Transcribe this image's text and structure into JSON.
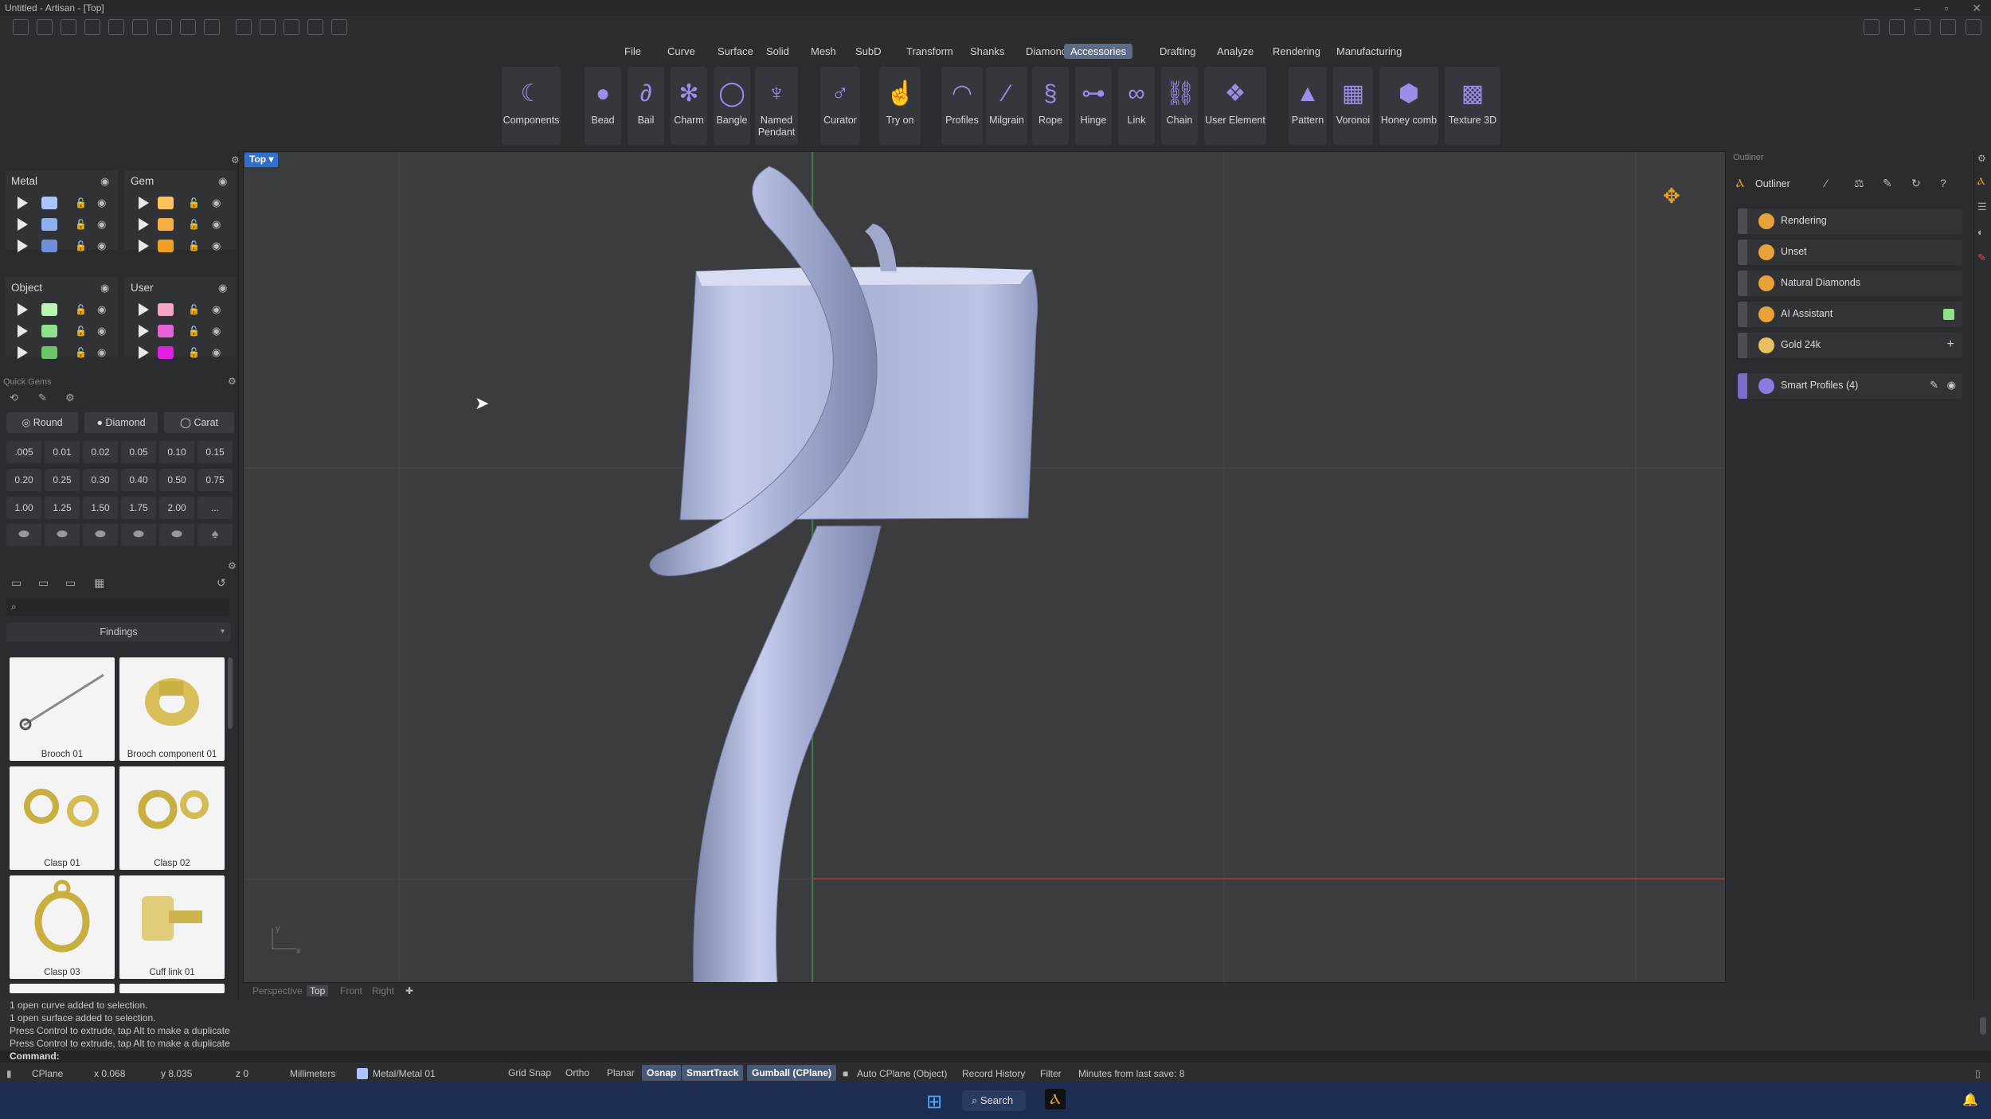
{
  "window": {
    "title": "Untitled - Artisan - [Top]"
  },
  "menu": [
    "File",
    "Curve",
    "Surface",
    "Solid",
    "Mesh",
    "SubD",
    "Transform",
    "Shanks",
    "Diamonds",
    "Accessories",
    "Drafting",
    "Analyze",
    "Rendering",
    "Manufacturing"
  ],
  "menu_active": "Accessories",
  "ribbon": {
    "tools": [
      {
        "label": "Components",
        "icon": "components-icon"
      },
      {
        "label": "Bead",
        "icon": "bead-icon"
      },
      {
        "label": "Bail",
        "icon": "bail-icon"
      },
      {
        "label": "Charm",
        "icon": "charm-icon"
      },
      {
        "label": "Bangle",
        "icon": "bangle-icon"
      },
      {
        "label": "Named Pendant",
        "icon": "named-pendant-icon"
      },
      {
        "label": "Curator",
        "icon": "curator-icon"
      },
      {
        "label": "Try on",
        "icon": "try-on-icon"
      },
      {
        "label": "Profiles",
        "icon": "profiles-icon"
      },
      {
        "label": "Milgrain",
        "icon": "milgrain-icon"
      },
      {
        "label": "Rope",
        "icon": "rope-icon"
      },
      {
        "label": "Hinge",
        "icon": "hinge-icon"
      },
      {
        "label": "Link",
        "icon": "link-icon"
      },
      {
        "label": "Chain",
        "icon": "chain-icon"
      },
      {
        "label": "User Element",
        "icon": "user-element-icon"
      },
      {
        "label": "Pattern",
        "icon": "pattern-icon"
      },
      {
        "label": "Voronoi",
        "icon": "voronoi-icon"
      },
      {
        "label": "Honey comb",
        "icon": "honeycomb-icon"
      },
      {
        "label": "Texture 3D",
        "icon": "texture-3d-icon"
      }
    ]
  },
  "layers": {
    "metal": {
      "title": "Metal",
      "colors": [
        "#a9c4ff",
        "#8db0f0",
        "#6f8fd8"
      ]
    },
    "gem": {
      "title": "Gem",
      "colors": [
        "#ffc15a",
        "#f7b040",
        "#f0a020"
      ]
    },
    "object": {
      "title": "Object",
      "colors": [
        "#b9f5b0",
        "#8fe08a",
        "#6cc468"
      ]
    },
    "user": {
      "title": "User",
      "colors": [
        "#f5a6c8",
        "#e860d8",
        "#e020e0"
      ]
    }
  },
  "quick_gems": {
    "title": "Quick Gems",
    "shape_buttons": [
      "Round",
      "Diamond",
      "Carat"
    ],
    "sizes": [
      ".005",
      "0.01",
      "0.02",
      "0.05",
      "0.10",
      "0.15",
      "0.20",
      "0.25",
      "0.30",
      "0.40",
      "0.50",
      "0.75",
      "1.00",
      "1.25",
      "1.50",
      "1.75",
      "2.00",
      "..."
    ]
  },
  "library": {
    "search_placeholder": "",
    "category": "Findings",
    "items": [
      "Brooch 01",
      "Brooch component 01",
      "Clasp 01",
      "Clasp 02",
      "Clasp 03",
      "Cuff link 01"
    ]
  },
  "viewport": {
    "label": "Top",
    "axis_y": "y",
    "axis_x": "x"
  },
  "view_tabs": [
    "Perspective",
    "Top",
    "Front",
    "Right"
  ],
  "view_tab_active": "Top",
  "outliner": {
    "title": "Outliner",
    "panel_label": "Outliner",
    "items": [
      {
        "label": "Rendering",
        "color": "#e8a23a"
      },
      {
        "label": "Unset",
        "color": "#e8a23a"
      },
      {
        "label": "Natural Diamonds",
        "color": "#e8a23a"
      },
      {
        "label": "AI Assistant",
        "color": "#e8a23a"
      },
      {
        "label": "Gold 24k",
        "color": "#e8c060"
      }
    ],
    "smart": "Smart Profiles (4)"
  },
  "history": [
    "1 open curve added to selection.",
    "1 open surface added to selection.",
    "Press Control to extrude, tap Alt to make a duplicate",
    "Press Control to extrude, tap Alt to make a duplicate"
  ],
  "command_label": "Command:",
  "status": {
    "cplane": "CPlane",
    "x": "x 0.068",
    "y": "y 8.035",
    "z": "z 0",
    "units": "Millimeters",
    "layer": "Metal/Metal 01",
    "toggles": [
      {
        "label": "Grid Snap",
        "on": false
      },
      {
        "label": "Ortho",
        "on": false
      },
      {
        "label": "Planar",
        "on": false
      },
      {
        "label": "Osnap",
        "on": true
      },
      {
        "label": "SmartTrack",
        "on": true
      },
      {
        "label": "Gumball (CPlane)",
        "on": true
      }
    ],
    "autocplane": "Auto CPlane (Object)",
    "record": "Record History",
    "filter": "Filter",
    "minutes": "Minutes from last save: 8"
  },
  "taskbar": {
    "search": "Search"
  }
}
